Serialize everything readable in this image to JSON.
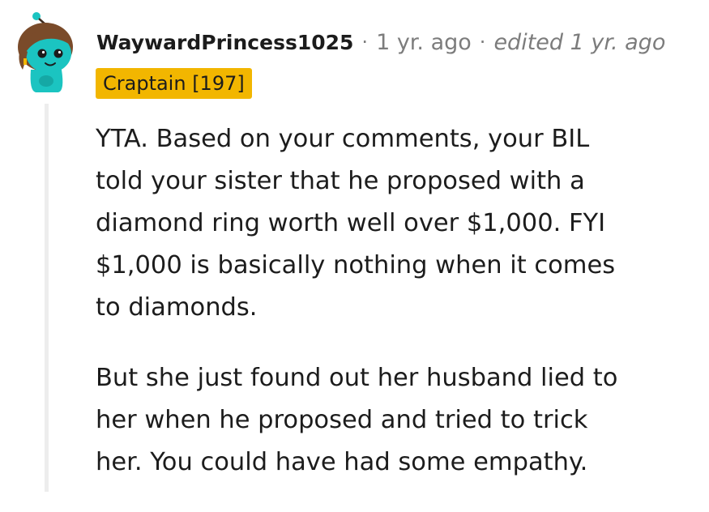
{
  "comment": {
    "author": "WaywardPrincess1025",
    "separator": "·",
    "timestamp": "1 yr. ago",
    "edited": "edited 1 yr. ago",
    "flair": "Craptain [197]",
    "avatar_icon": "snoo-avatar-icon",
    "paragraphs": [
      {
        "lines": [
          "YTA. Based on your comments, your BIL",
          "told your sister that he proposed with a",
          "diamond ring worth well over $1,000. FYI",
          "$1,000 is basically nothing when it comes",
          "to diamonds."
        ]
      },
      {
        "lines": [
          "But she just found out her husband lied to",
          "her when he proposed and tried to trick",
          "her. You could have had some empathy."
        ]
      }
    ]
  },
  "colors": {
    "flair_background": "#f2b600",
    "avatar_teal": "#1bc4c1",
    "meta_gray": "#7c7c7c",
    "text": "#1c1c1c",
    "thread_line": "#ededed"
  }
}
